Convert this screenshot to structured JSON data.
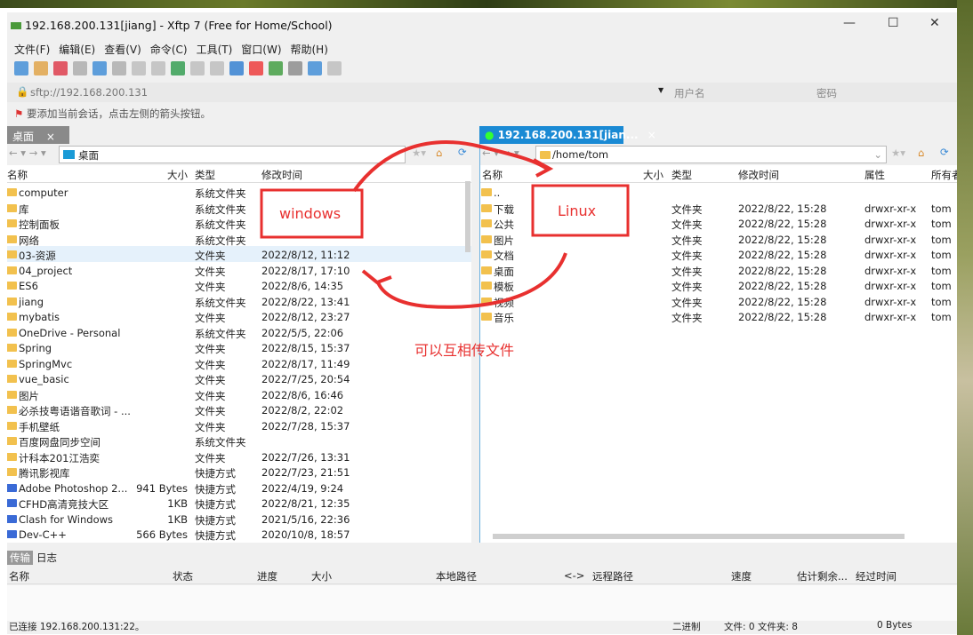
{
  "window": {
    "title": "192.168.200.131[jiang] - Xftp 7 (Free for Home/School)",
    "minimize": "—",
    "maximize": "☐",
    "close": "✕"
  },
  "menu": [
    "文件(F)",
    "编辑(E)",
    "查看(V)",
    "命令(C)",
    "工具(T)",
    "窗口(W)",
    "帮助(H)"
  ],
  "toolbar_icons": [
    "new-session-icon",
    "open-folder-icon",
    "disconnect-icon",
    "reconnect-icon",
    "new-window-icon",
    "terminal-icon",
    "upload-icon",
    "download-icon",
    "transfer-icon",
    "copy-icon",
    "paste-icon",
    "globe-icon",
    "xshell-icon",
    "xftp-icon",
    "settings-icon",
    "help-icon",
    "chat-icon"
  ],
  "address": {
    "url": "sftp://192.168.200.131",
    "username_placeholder": "用户名",
    "password_placeholder": "密码"
  },
  "hint": "要添加当前会话，点击左侧的箭头按钮。",
  "left": {
    "tab": "桌面",
    "path": "桌面",
    "columns": [
      "名称",
      "大小",
      "类型",
      "修改时间"
    ],
    "rows": [
      [
        "computer",
        "",
        "系统文件夹",
        ""
      ],
      [
        "库",
        "",
        "系统文件夹",
        ""
      ],
      [
        "控制面板",
        "",
        "系统文件夹",
        ""
      ],
      [
        "网络",
        "",
        "系统文件夹",
        ""
      ],
      [
        "03-资源",
        "",
        "文件夹",
        "2022/8/12, 11:12"
      ],
      [
        "04_project",
        "",
        "文件夹",
        "2022/8/17, 17:10"
      ],
      [
        "ES6",
        "",
        "文件夹",
        "2022/8/6, 14:35"
      ],
      [
        "jiang",
        "",
        "系统文件夹",
        "2022/8/22, 13:41"
      ],
      [
        "mybatis",
        "",
        "文件夹",
        "2022/8/12, 23:27"
      ],
      [
        "OneDrive - Personal",
        "",
        "系统文件夹",
        "2022/5/5, 22:06"
      ],
      [
        "Spring",
        "",
        "文件夹",
        "2022/8/15, 15:37"
      ],
      [
        "SpringMvc",
        "",
        "文件夹",
        "2022/8/17, 11:49"
      ],
      [
        "vue_basic",
        "",
        "文件夹",
        "2022/7/25, 20:54"
      ],
      [
        "图片",
        "",
        "文件夹",
        "2022/8/6, 16:46"
      ],
      [
        "必杀技粤语谐音歌词 - ...",
        "",
        "文件夹",
        "2022/8/2, 22:02"
      ],
      [
        "手机壁纸",
        "",
        "文件夹",
        "2022/7/28, 15:37"
      ],
      [
        "百度网盘同步空间",
        "",
        "系统文件夹",
        ""
      ],
      [
        "计科本201江浩奕",
        "",
        "文件夹",
        "2022/7/26, 13:31"
      ],
      [
        "腾讯影视库",
        "",
        "快捷方式",
        "2022/7/23, 21:51"
      ],
      [
        "Adobe Photoshop 2...",
        "941 Bytes",
        "快捷方式",
        "2022/4/19, 9:24"
      ],
      [
        "CFHD高清竞技大区",
        "1KB",
        "快捷方式",
        "2022/8/21, 12:35"
      ],
      [
        "Clash for Windows",
        "1KB",
        "快捷方式",
        "2021/5/16, 22:36"
      ],
      [
        "Dev-C++",
        "566 Bytes",
        "快捷方式",
        "2020/10/8, 18:57"
      ]
    ],
    "selected_index": 4
  },
  "right": {
    "tab": "192.168.200.131[jian...",
    "path": "/home/tom",
    "columns": [
      "名称",
      "大小",
      "类型",
      "修改时间",
      "属性",
      "所有者"
    ],
    "rows": [
      [
        "..",
        "",
        "",
        "",
        "",
        ""
      ],
      [
        "下载",
        "",
        "文件夹",
        "2022/8/22, 15:28",
        "drwxr-xr-x",
        "tom"
      ],
      [
        "公共",
        "",
        "文件夹",
        "2022/8/22, 15:28",
        "drwxr-xr-x",
        "tom"
      ],
      [
        "图片",
        "",
        "文件夹",
        "2022/8/22, 15:28",
        "drwxr-xr-x",
        "tom"
      ],
      [
        "文档",
        "",
        "文件夹",
        "2022/8/22, 15:28",
        "drwxr-xr-x",
        "tom"
      ],
      [
        "桌面",
        "",
        "文件夹",
        "2022/8/22, 15:28",
        "drwxr-xr-x",
        "tom"
      ],
      [
        "模板",
        "",
        "文件夹",
        "2022/8/22, 15:28",
        "drwxr-xr-x",
        "tom"
      ],
      [
        "视频",
        "",
        "文件夹",
        "2022/8/22, 15:28",
        "drwxr-xr-x",
        "tom"
      ],
      [
        "音乐",
        "",
        "文件夹",
        "2022/8/22, 15:28",
        "drwxr-xr-x",
        "tom"
      ]
    ]
  },
  "transfer": {
    "tabs": [
      "传输",
      "日志"
    ],
    "columns": [
      "名称",
      "状态",
      "进度",
      "大小",
      "本地路径",
      "<->",
      "远程路径",
      "速度",
      "估计剩余...",
      "经过时间"
    ]
  },
  "status": {
    "connection": "已连接 192.168.200.131:22。",
    "mode": "二进制",
    "counts": "文件: 0  文件夹: 8",
    "size": "0 Bytes"
  },
  "annotations": {
    "left_label": "windows",
    "right_label": "Linux",
    "caption": "可以互相传文件",
    "color": "#e8302f"
  }
}
